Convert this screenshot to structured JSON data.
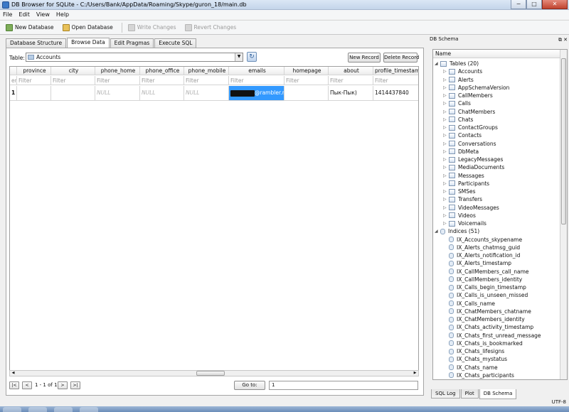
{
  "window": {
    "title": "DB Browser for SQLite - C:/Users/Bank/AppData/Roaming/Skype/guron_18/main.db",
    "controls": [
      "−",
      "□",
      "✕"
    ]
  },
  "menu": [
    "File",
    "Edit",
    "View",
    "Help"
  ],
  "toolbar": {
    "new_db": "New Database",
    "open_db": "Open Database",
    "write_changes": "Write Changes",
    "revert_changes": "Revert Changes"
  },
  "tabs": [
    "Database Structure",
    "Browse Data",
    "Edit Pragmas",
    "Execute SQL"
  ],
  "browse": {
    "table_label": "Table:",
    "table_value": "Accounts",
    "new_record": "New Record",
    "delete_record": "Delete Record",
    "columns": [
      "province",
      "city",
      "phone_home",
      "phone_office",
      "phone_mobile",
      "emails",
      "homepage",
      "about",
      "profile_timestamp"
    ],
    "filter_first": "er",
    "filter_placeholder": "Filter",
    "row_number": "1",
    "row": [
      "",
      "",
      "NULL",
      "NULL",
      "NULL",
      "@rambler.ru",
      "",
      "Пык-Пык)",
      "1414437840"
    ],
    "nav_first": "|<",
    "nav_prev": "<",
    "record_info": "1 - 1 of 1",
    "nav_next": ">",
    "nav_last": ">|",
    "goto_label": "Go to:",
    "goto_value": "1"
  },
  "schema": {
    "dock_title": "DB Schema",
    "column_header": "Name",
    "tables_label": "Tables (20)",
    "tables": [
      "Accounts",
      "Alerts",
      "AppSchemaVersion",
      "CallMembers",
      "Calls",
      "ChatMembers",
      "Chats",
      "ContactGroups",
      "Contacts",
      "Conversations",
      "DbMeta",
      "LegacyMessages",
      "MediaDocuments",
      "Messages",
      "Participants",
      "SMSes",
      "Transfers",
      "VideoMessages",
      "Videos",
      "Voicemails"
    ],
    "indices_label": "Indices (51)",
    "indices": [
      "IX_Accounts_skypename",
      "IX_Alerts_chatmsg_guid",
      "IX_Alerts_notification_id",
      "IX_Alerts_timestamp",
      "IX_CallMembers_call_name",
      "IX_CallMembers_identity",
      "IX_Calls_begin_timestamp",
      "IX_Calls_is_unseen_missed",
      "IX_Calls_name",
      "IX_ChatMembers_chatname",
      "IX_ChatMembers_identity",
      "IX_Chats_activity_timestamp",
      "IX_Chats_first_unread_message",
      "IX_Chats_is_bookmarked",
      "IX_Chats_lifesigns",
      "IX_Chats_mystatus",
      "IX_Chats_name",
      "IX_Chats_participants"
    ]
  },
  "dock_tabs": [
    "SQL Log",
    "Plot",
    "DB Schema"
  ],
  "status": {
    "encoding": "UTF-8"
  },
  "colors": {
    "selection": "#3399ff",
    "titlebar": "#c4d5ea"
  }
}
